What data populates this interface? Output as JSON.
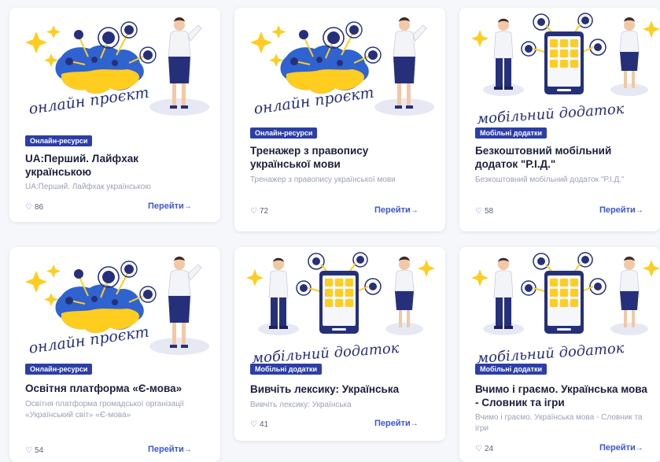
{
  "colors": {
    "badge_bg": "#2c3ea8",
    "accent": "#3c56d6",
    "title": "#1c1f3b",
    "muted": "#9ca2b5"
  },
  "cards": [
    {
      "illustration": "online-project",
      "illustration_caption": "онлайн проєкт",
      "category": "Онлайн-ресурси",
      "title": "UA:Перший. Лайфхак українською",
      "description": "UA:Перший. Лайфхак українською",
      "likes": "86",
      "go_label": "Перейти",
      "go_icon": "arrow-right-icon"
    },
    {
      "illustration": "online-project",
      "illustration_caption": "онлайн проєкт",
      "category": "Онлайн-ресурси",
      "title": "Тренажер з правопису української мови",
      "description": "Тренажер з правопису української мови",
      "likes": "72",
      "go_label": "Перейти",
      "go_icon": "arrow-right-icon"
    },
    {
      "illustration": "mobile-app",
      "illustration_caption": "мобільний додаток",
      "category": "Мобільні додатки",
      "title": "Безкоштовний мобільний додаток \"Р.І.Д.\"",
      "description": "Безкоштовний мобільний додаток \"Р.І.Д.\"",
      "likes": "58",
      "go_label": "Перейти",
      "go_icon": "arrow-right-icon"
    },
    {
      "illustration": "online-project",
      "illustration_caption": "онлайн проєкт",
      "category": "Онлайн-ресурси",
      "title": "Освітня платформа «Є-мова»",
      "description": "Освітня платформа громадської організації «Український світ» «Є-мова»",
      "likes": "54",
      "go_label": "Перейти",
      "go_icon": "arrow-right-icon"
    },
    {
      "illustration": "mobile-app",
      "illustration_caption": "мобільний додаток",
      "category": "Мобільні додатки",
      "title": "Вивчіть лексику: Українська",
      "description": "Вивчіть лексику: Українська",
      "likes": "41",
      "go_label": "Перейти",
      "go_icon": "arrow-right-icon"
    },
    {
      "illustration": "mobile-app",
      "illustration_caption": "мобільний додаток",
      "category": "Мобільні додатки",
      "title": "Вчимо і граємо. Українська мова - Словник та ігри",
      "description": "Вчимо і граємо. Українська мова - Словник та ігри",
      "likes": "24",
      "go_label": "Перейти",
      "go_icon": "arrow-right-icon"
    }
  ]
}
